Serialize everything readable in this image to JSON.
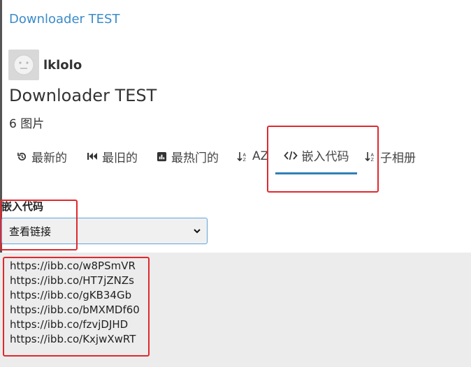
{
  "breadcrumb": "Downloader TEST",
  "user": {
    "name": "lklolo"
  },
  "album": {
    "title": "Downloader TEST",
    "count": "6 图片"
  },
  "tabs": [
    {
      "label": "最新的",
      "icon": "history-icon"
    },
    {
      "label": "最旧的",
      "icon": "skip-back-icon"
    },
    {
      "label": "最热门的",
      "icon": "chart-icon"
    },
    {
      "label": "AZ",
      "icon": "sort-alpha-icon"
    },
    {
      "label": "嵌入代码",
      "icon": "code-icon",
      "active": true
    },
    {
      "label": "子相册",
      "icon": "sort-alpha-icon"
    }
  ],
  "embed": {
    "label": "嵌入代码",
    "selected": "查看链接"
  },
  "links": [
    "https://ibb.co/w8PSmVR",
    "https://ibb.co/HT7jZNZs",
    "https://ibb.co/gKB34Gb",
    "https://ibb.co/bMXMDf60",
    "https://ibb.co/fzvjDJHD",
    "https://ibb.co/KxjwXwRT"
  ],
  "colors": {
    "link": "#3a8bc9",
    "active_tab_underline": "#2f7fb5",
    "annotation": "#e0282e",
    "code_background": "#ececec"
  }
}
